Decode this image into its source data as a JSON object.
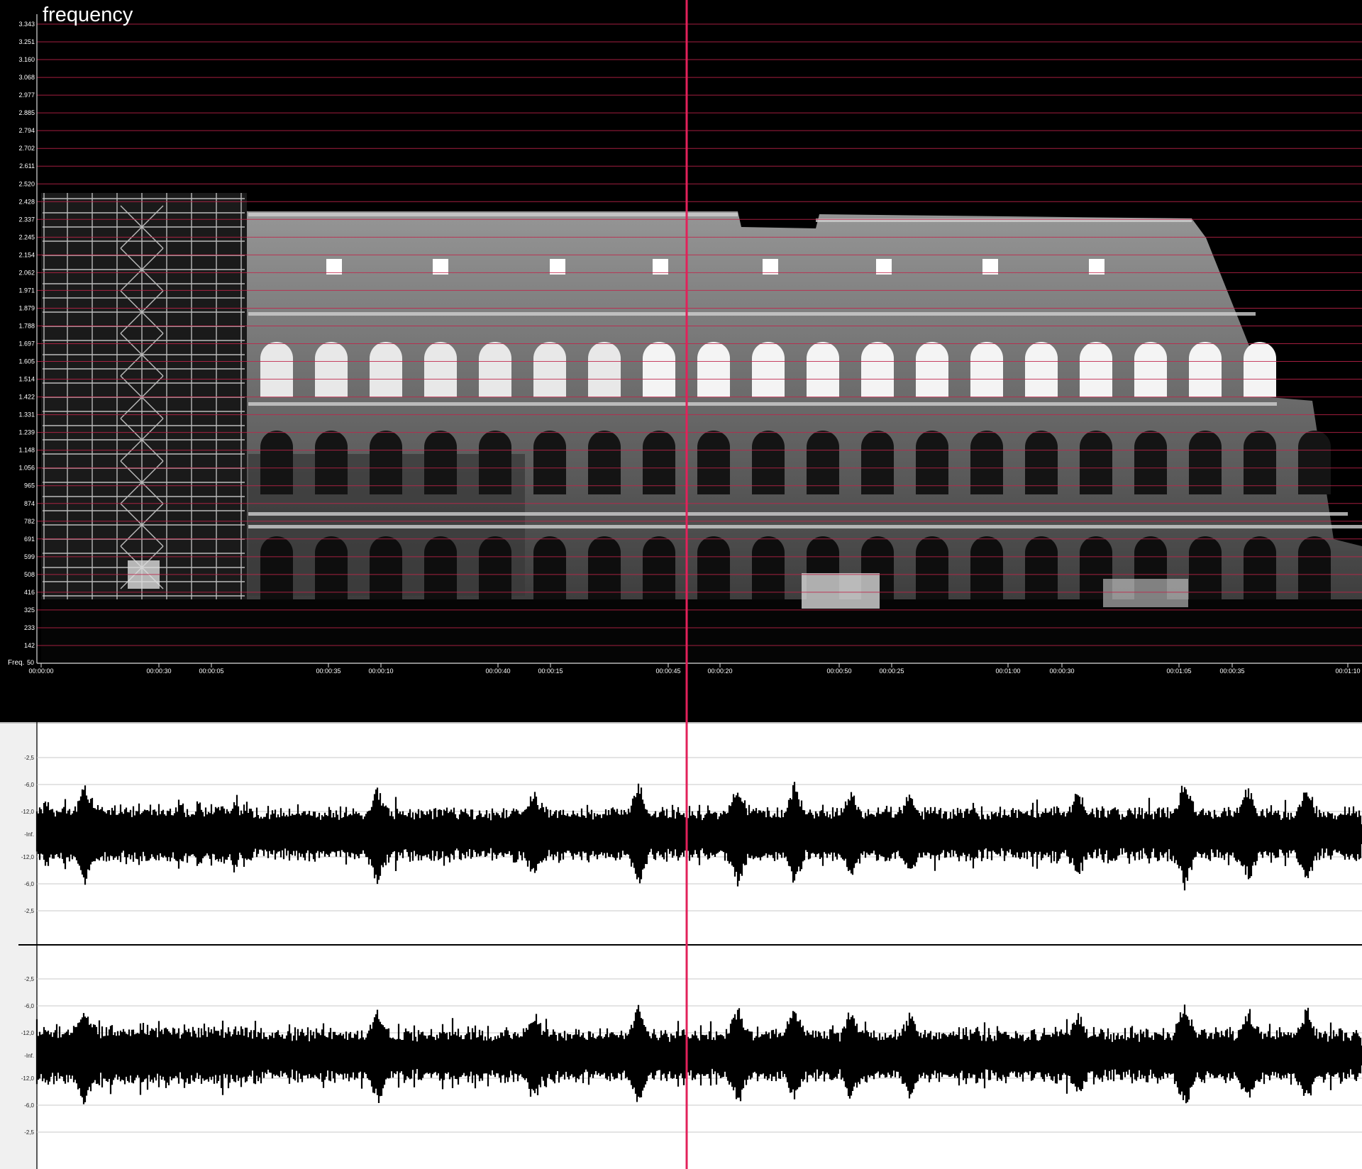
{
  "spectrogram": {
    "title": "frequency",
    "axis_label": "Freq.",
    "freq_ticks": [
      "3.343",
      "3.251",
      "3.160",
      "3.068",
      "2.977",
      "2.885",
      "2.794",
      "2.702",
      "2.611",
      "2.520",
      "2.428",
      "2.337",
      "2.245",
      "2.154",
      "2.062",
      "1.971",
      "1.879",
      "1.788",
      "1.697",
      "1.605",
      "1.514",
      "1.422",
      "1.331",
      "1.239",
      "1.148",
      "1.056",
      "965",
      "874",
      "782",
      "691",
      "599",
      "508",
      "416",
      "325",
      "233",
      "142",
      "50"
    ],
    "time_ticks": [
      "00:00:00",
      "00:00:30",
      "00:00:05",
      "00:00:35",
      "00:00:10",
      "00:00:40",
      "00:00:15",
      "00:00:45",
      "00:00:20",
      "00:00:50",
      "00:00:25",
      "00:01:00",
      "00:00:30",
      "00:01:05",
      "00:00:35",
      "00:01:10"
    ],
    "background_image": "colosseum-facade-photograph",
    "gridline_color": "#c0244a",
    "background_color": "#000000"
  },
  "waveform": {
    "db_ticks": [
      "-2,5",
      "-6,0",
      "-12,0",
      "-Inf.",
      "-12,0",
      "-6,0",
      "-2,5"
    ],
    "channels": [
      "left-channel",
      "right-channel"
    ],
    "background_color": "#ffffff",
    "wave_color": "#000000"
  },
  "playhead": {
    "color": "#e2215a"
  }
}
